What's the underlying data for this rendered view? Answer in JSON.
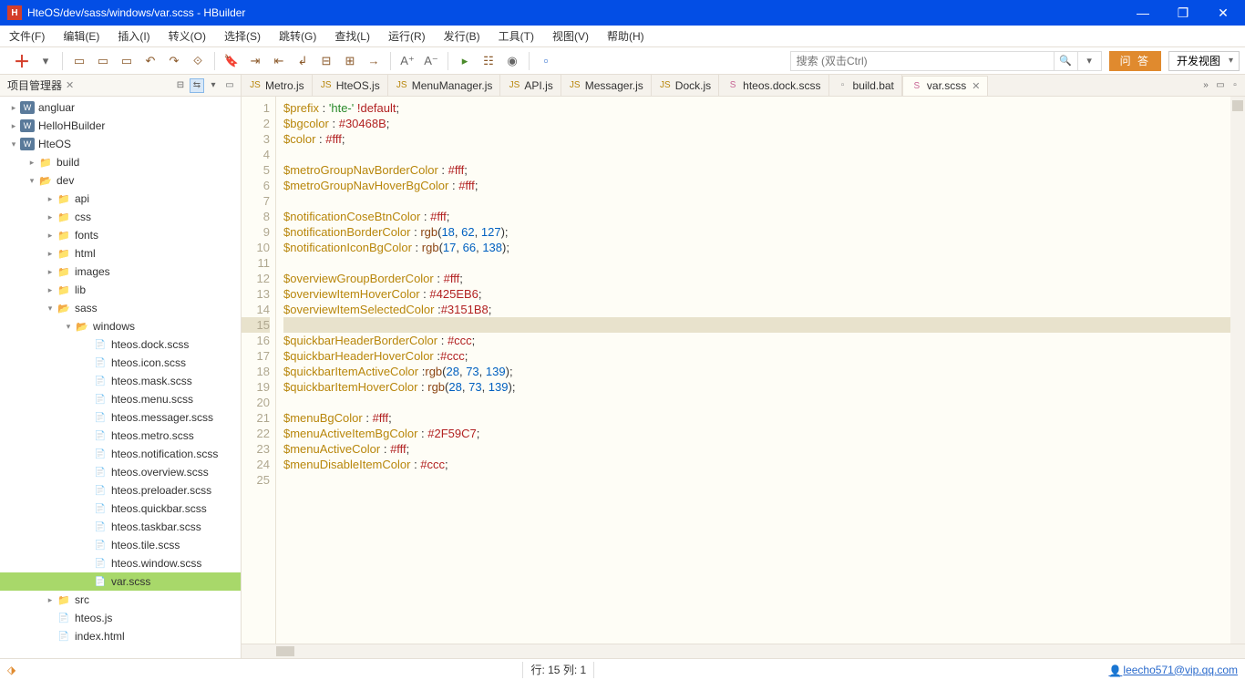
{
  "window": {
    "title": "HteOS/dev/sass/windows/var.scss  -  HBuilder"
  },
  "menu": [
    "文件(F)",
    "编辑(E)",
    "插入(I)",
    "转义(O)",
    "选择(S)",
    "跳转(G)",
    "查找(L)",
    "运行(R)",
    "发行(B)",
    "工具(T)",
    "视图(V)",
    "帮助(H)"
  ],
  "toolbar": {
    "search_placeholder": "搜索 (双击Ctrl)",
    "qa": "问 答",
    "perspective": "开发视图"
  },
  "sidebar": {
    "title": "项目管理器"
  },
  "tree": [
    {
      "d": 0,
      "t": "proj",
      "a": "r",
      "l": "angluar"
    },
    {
      "d": 0,
      "t": "proj",
      "a": "r",
      "l": "HelloHBuilder"
    },
    {
      "d": 0,
      "t": "proj",
      "a": "d",
      "l": "HteOS"
    },
    {
      "d": 1,
      "t": "folder",
      "a": "r",
      "l": "build"
    },
    {
      "d": 1,
      "t": "folder",
      "a": "d",
      "l": "dev"
    },
    {
      "d": 2,
      "t": "folder",
      "a": "r",
      "l": "api"
    },
    {
      "d": 2,
      "t": "folder",
      "a": "r",
      "l": "css"
    },
    {
      "d": 2,
      "t": "folder",
      "a": "r",
      "l": "fonts"
    },
    {
      "d": 2,
      "t": "folder",
      "a": "r",
      "l": "html"
    },
    {
      "d": 2,
      "t": "folder",
      "a": "r",
      "l": "images"
    },
    {
      "d": 2,
      "t": "folder",
      "a": "r",
      "l": "lib"
    },
    {
      "d": 2,
      "t": "folder",
      "a": "d",
      "l": "sass"
    },
    {
      "d": 3,
      "t": "folder",
      "a": "d",
      "l": "windows"
    },
    {
      "d": 4,
      "t": "file",
      "l": "hteos.dock.scss"
    },
    {
      "d": 4,
      "t": "file",
      "l": "hteos.icon.scss"
    },
    {
      "d": 4,
      "t": "file",
      "l": "hteos.mask.scss"
    },
    {
      "d": 4,
      "t": "file",
      "l": "hteos.menu.scss"
    },
    {
      "d": 4,
      "t": "file",
      "l": "hteos.messager.scss"
    },
    {
      "d": 4,
      "t": "file",
      "l": "hteos.metro.scss"
    },
    {
      "d": 4,
      "t": "file",
      "l": "hteos.notification.scss"
    },
    {
      "d": 4,
      "t": "file",
      "l": "hteos.overview.scss"
    },
    {
      "d": 4,
      "t": "file",
      "l": "hteos.preloader.scss"
    },
    {
      "d": 4,
      "t": "file",
      "l": "hteos.quickbar.scss"
    },
    {
      "d": 4,
      "t": "file",
      "l": "hteos.taskbar.scss"
    },
    {
      "d": 4,
      "t": "file",
      "l": "hteos.tile.scss"
    },
    {
      "d": 4,
      "t": "file",
      "l": "hteos.window.scss"
    },
    {
      "d": 4,
      "t": "file",
      "l": "var.scss",
      "sel": true
    },
    {
      "d": 2,
      "t": "folder",
      "a": "r",
      "l": "src"
    },
    {
      "d": 2,
      "t": "file",
      "i": "js",
      "l": "hteos.js"
    },
    {
      "d": 2,
      "t": "file",
      "i": "html",
      "l": "index.html"
    }
  ],
  "tabs": [
    {
      "l": "Metro.js",
      "k": "js"
    },
    {
      "l": "HteOS.js",
      "k": "js"
    },
    {
      "l": "MenuManager.js",
      "k": "js"
    },
    {
      "l": "API.js",
      "k": "js"
    },
    {
      "l": "Messager.js",
      "k": "js"
    },
    {
      "l": "Dock.js",
      "k": "js"
    },
    {
      "l": "hteos.dock.scss",
      "k": "scss"
    },
    {
      "l": "build.bat",
      "k": "bat"
    },
    {
      "l": "var.scss",
      "k": "scss",
      "active": true,
      "close": true
    }
  ],
  "code": [
    [
      [
        "var",
        "$prefix"
      ],
      [
        "punc",
        " : "
      ],
      [
        "str",
        "'hte-'"
      ],
      [
        "kw",
        " !default"
      ],
      [
        "punc",
        ";"
      ]
    ],
    [
      [
        "var",
        "$bgcolor"
      ],
      [
        "punc",
        " : "
      ],
      [
        "hex",
        "#30468B"
      ],
      [
        "punc",
        ";"
      ]
    ],
    [
      [
        "var",
        "$color"
      ],
      [
        "punc",
        " : "
      ],
      [
        "hex",
        "#fff"
      ],
      [
        "punc",
        ";"
      ]
    ],
    [],
    [
      [
        "var",
        "$metroGroupNavBorderColor"
      ],
      [
        "punc",
        " : "
      ],
      [
        "hex",
        "#fff"
      ],
      [
        "punc",
        ";"
      ]
    ],
    [
      [
        "var",
        "$metroGroupNavHoverBgColor"
      ],
      [
        "punc",
        " : "
      ],
      [
        "hex",
        "#fff"
      ],
      [
        "punc",
        ";"
      ]
    ],
    [],
    [
      [
        "var",
        "$notificationCoseBtnColor"
      ],
      [
        "punc",
        " : "
      ],
      [
        "hex",
        "#fff"
      ],
      [
        "punc",
        ";"
      ]
    ],
    [
      [
        "var",
        "$notificationBorderColor"
      ],
      [
        "punc",
        " : "
      ],
      [
        "fn",
        "rgb"
      ],
      [
        "punc",
        "("
      ],
      [
        "num",
        "18"
      ],
      [
        "punc",
        ", "
      ],
      [
        "num",
        "62"
      ],
      [
        "punc",
        ", "
      ],
      [
        "num",
        "127"
      ],
      [
        "punc",
        ");"
      ]
    ],
    [
      [
        "var",
        "$notificationIconBgColor"
      ],
      [
        "punc",
        " : "
      ],
      [
        "fn",
        "rgb"
      ],
      [
        "punc",
        "("
      ],
      [
        "num",
        "17"
      ],
      [
        "punc",
        ", "
      ],
      [
        "num",
        "66"
      ],
      [
        "punc",
        ", "
      ],
      [
        "num",
        "138"
      ],
      [
        "punc",
        ");"
      ]
    ],
    [],
    [
      [
        "var",
        "$overviewGroupBorderColor"
      ],
      [
        "punc",
        " : "
      ],
      [
        "hex",
        "#fff"
      ],
      [
        "punc",
        ";"
      ]
    ],
    [
      [
        "var",
        "$overviewItemHoverColor"
      ],
      [
        "punc",
        " : "
      ],
      [
        "hex",
        "#425EB6"
      ],
      [
        "punc",
        ";"
      ]
    ],
    [
      [
        "var",
        "$overviewItemSelectedColor"
      ],
      [
        "punc",
        " :"
      ],
      [
        "hex",
        "#3151B8"
      ],
      [
        "punc",
        ";"
      ]
    ],
    [],
    [
      [
        "var",
        "$quickbarHeaderBorderColor"
      ],
      [
        "punc",
        " : "
      ],
      [
        "hex",
        "#ccc"
      ],
      [
        "punc",
        ";"
      ]
    ],
    [
      [
        "var",
        "$quickbarHeaderHoverColor"
      ],
      [
        "punc",
        " :"
      ],
      [
        "hex",
        "#ccc"
      ],
      [
        "punc",
        ";"
      ]
    ],
    [
      [
        "var",
        "$quickbarItemActiveColor"
      ],
      [
        "punc",
        " :"
      ],
      [
        "fn",
        "rgb"
      ],
      [
        "punc",
        "("
      ],
      [
        "num",
        "28"
      ],
      [
        "punc",
        ", "
      ],
      [
        "num",
        "73"
      ],
      [
        "punc",
        ", "
      ],
      [
        "num",
        "139"
      ],
      [
        "punc",
        ");"
      ]
    ],
    [
      [
        "var",
        "$quickbarItemHoverColor"
      ],
      [
        "punc",
        " : "
      ],
      [
        "fn",
        "rgb"
      ],
      [
        "punc",
        "("
      ],
      [
        "num",
        "28"
      ],
      [
        "punc",
        ", "
      ],
      [
        "num",
        "73"
      ],
      [
        "punc",
        ", "
      ],
      [
        "num",
        "139"
      ],
      [
        "punc",
        ");"
      ]
    ],
    [],
    [
      [
        "var",
        "$menuBgColor"
      ],
      [
        "punc",
        " : "
      ],
      [
        "hex",
        "#fff"
      ],
      [
        "punc",
        ";"
      ]
    ],
    [
      [
        "var",
        "$menuActiveItemBgColor"
      ],
      [
        "punc",
        " : "
      ],
      [
        "hex",
        "#2F59C7"
      ],
      [
        "punc",
        ";"
      ]
    ],
    [
      [
        "var",
        "$menuActiveColor"
      ],
      [
        "punc",
        " : "
      ],
      [
        "hex",
        "#fff"
      ],
      [
        "punc",
        ";"
      ]
    ],
    [
      [
        "var",
        "$menuDisableItemColor"
      ],
      [
        "punc",
        " : "
      ],
      [
        "hex",
        "#ccc"
      ],
      [
        "punc",
        ";"
      ]
    ],
    []
  ],
  "cursor_line": 15,
  "status": {
    "pos": "行: 15 列: 1",
    "user": "leecho571@vip.qq.com"
  }
}
